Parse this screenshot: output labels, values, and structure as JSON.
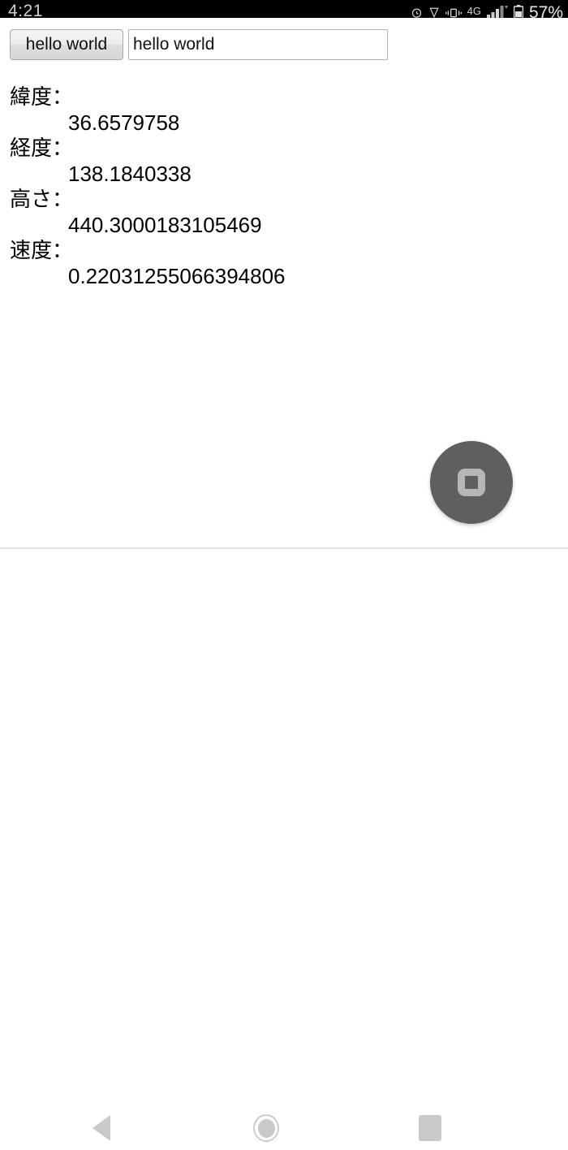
{
  "status_bar": {
    "clock": "4:21",
    "network_label": "4G",
    "battery_percent": "57%",
    "icons": [
      "alarm-icon",
      "vpn-key-icon",
      "vibrate-icon",
      "signal-bars-icon",
      "battery-icon"
    ],
    "background_color": "#000000",
    "text_color": "#cfcfcf"
  },
  "form": {
    "button_label": "hello world",
    "input_value": "hello world",
    "input_placeholder": ""
  },
  "readout": {
    "latitude": {
      "label": "緯度：",
      "value": "36.6579758"
    },
    "longitude": {
      "label": "経度：",
      "value": "138.1840338"
    },
    "altitude": {
      "label": "高さ：",
      "value": "440.3000183105469"
    },
    "speed": {
      "label": "速度：",
      "value": "0.22031255066394806"
    }
  },
  "fab": {
    "name": "stop-recording-button",
    "icon": "stop-square-icon",
    "background_color": "#5f5f5f",
    "icon_color": "#b6b6b6"
  },
  "nav_bar": {
    "back": "back-triangle-icon",
    "home": "home-circle-icon",
    "recents": "recents-square-icon",
    "icon_color": "#c9c9c9"
  }
}
